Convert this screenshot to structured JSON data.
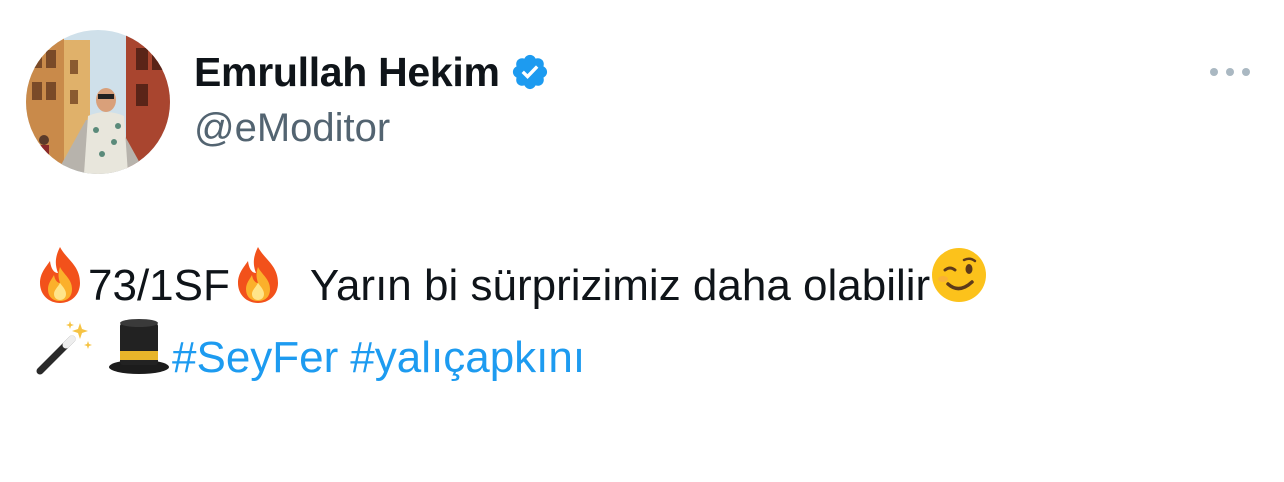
{
  "author": {
    "display_name": "Emrullah Hekim",
    "handle": "@eModitor",
    "verified": true
  },
  "tweet": {
    "line1": {
      "score": "73/1SF",
      "text": "Yarın bi sürprizimiz daha olabilir"
    },
    "hashtags": [
      "#SeyFer",
      "#yalıçapkını"
    ]
  },
  "icons": {
    "verified": "verified-badge-icon",
    "more": "more-options-icon",
    "fire": "fire-emoji",
    "wink": "winking-face-emoji",
    "wand": "magic-wand-emoji",
    "hat": "top-hat-emoji"
  },
  "colors": {
    "text": "#0f1419",
    "secondary": "#536471",
    "accent": "#1d9bf0"
  }
}
